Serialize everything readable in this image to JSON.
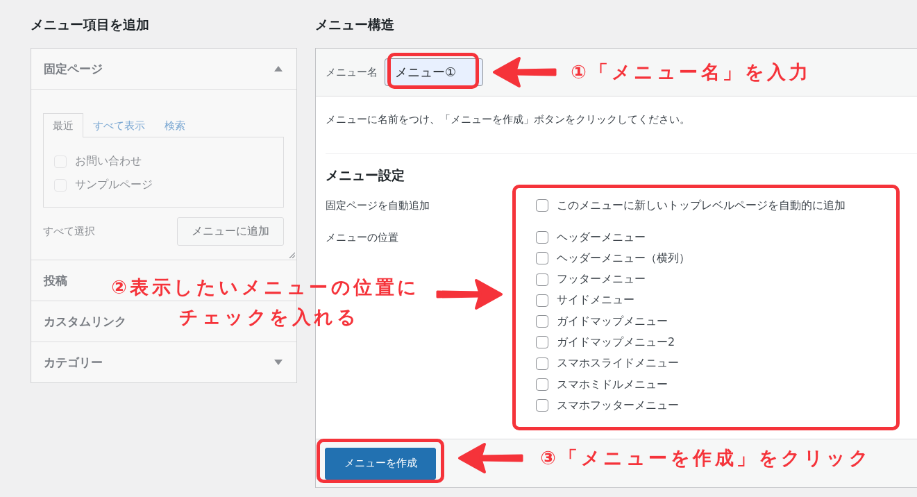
{
  "add_items": {
    "title": "メニュー項目を追加",
    "disabled": true,
    "sections": [
      {
        "title": "固定ページ",
        "expanded": true,
        "tabs": [
          {
            "label": "最近",
            "selected": true
          },
          {
            "label": "すべて表示",
            "selected": false
          },
          {
            "label": "検索",
            "selected": false
          }
        ],
        "items": [
          {
            "label": "お問い合わせ",
            "checked": false
          },
          {
            "label": "サンプルページ",
            "checked": false
          }
        ],
        "select_all": "すべて選択",
        "add_button": "メニューに追加"
      },
      {
        "title": "投稿",
        "expanded": false
      },
      {
        "title": "カスタムリンク",
        "expanded": false
      },
      {
        "title": "カテゴリー",
        "expanded": false
      }
    ]
  },
  "structure": {
    "title": "メニュー構造",
    "name_label": "メニュー名",
    "name_value": "メニュー①",
    "description": "メニューに名前をつけ、「メニューを作成」ボタンをクリックしてください。",
    "settings_title": "メニュー設定",
    "auto_add": {
      "label": "固定ページを自動追加",
      "option": {
        "label": "このメニューに新しいトップレベルページを自動的に追加",
        "checked": false
      }
    },
    "locations": {
      "label": "メニューの位置",
      "options": [
        {
          "label": "ヘッダーメニュー",
          "checked": false
        },
        {
          "label": "ヘッダーメニュー（横列）",
          "checked": false
        },
        {
          "label": "フッターメニュー",
          "checked": false
        },
        {
          "label": "サイドメニュー",
          "checked": false
        },
        {
          "label": "ガイドマップメニュー",
          "checked": false
        },
        {
          "label": "ガイドマップメニュー2",
          "checked": false
        },
        {
          "label": "スマホスライドメニュー",
          "checked": false
        },
        {
          "label": "スマホミドルメニュー",
          "checked": false
        },
        {
          "label": "スマホフッターメニュー",
          "checked": false
        }
      ]
    },
    "create_button": "メニューを作成"
  },
  "annotations": [
    {
      "kind": "name-field",
      "lines": [
        "①「メニュー名」を入力"
      ]
    },
    {
      "kind": "locations",
      "lines": [
        "②表示したいメニューの位置に",
        "チェックを入れる"
      ]
    },
    {
      "kind": "create-button",
      "lines": [
        "③「メニューを作成」をクリック"
      ]
    }
  ]
}
